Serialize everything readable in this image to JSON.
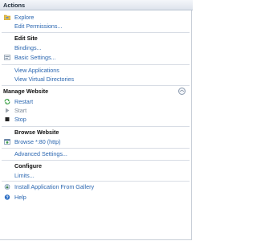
{
  "header": {
    "title": "Actions"
  },
  "items": {
    "explore": "Explore",
    "edit_permissions": "Edit Permissions...",
    "edit_site": "Edit Site",
    "bindings": "Bindings...",
    "basic_settings": "Basic Settings...",
    "view_applications": "View Applications",
    "view_virtual_directories": "View Virtual Directories",
    "manage_website": "Manage Website",
    "restart": "Restart",
    "start": "Start",
    "stop": "Stop",
    "browse_website": "Browse Website",
    "browse_80": "Browse *:80 (http)",
    "advanced_settings": "Advanced Settings...",
    "configure": "Configure",
    "limits": "Limits...",
    "install_gallery": "Install Application From Gallery",
    "help": "Help"
  },
  "icons": {
    "explore": "folder-icon",
    "basic_settings": "settings-page-icon",
    "collapse": "chevron-up-icon",
    "restart": "restart-icon",
    "start": "start-icon",
    "stop": "stop-icon",
    "browse": "browser-icon",
    "install": "gallery-install-icon",
    "help": "help-icon"
  },
  "colors": {
    "link": "#2a66b0",
    "header_bg": "#dde3ec",
    "stop": "#222222",
    "start": "#9aa3ad"
  }
}
